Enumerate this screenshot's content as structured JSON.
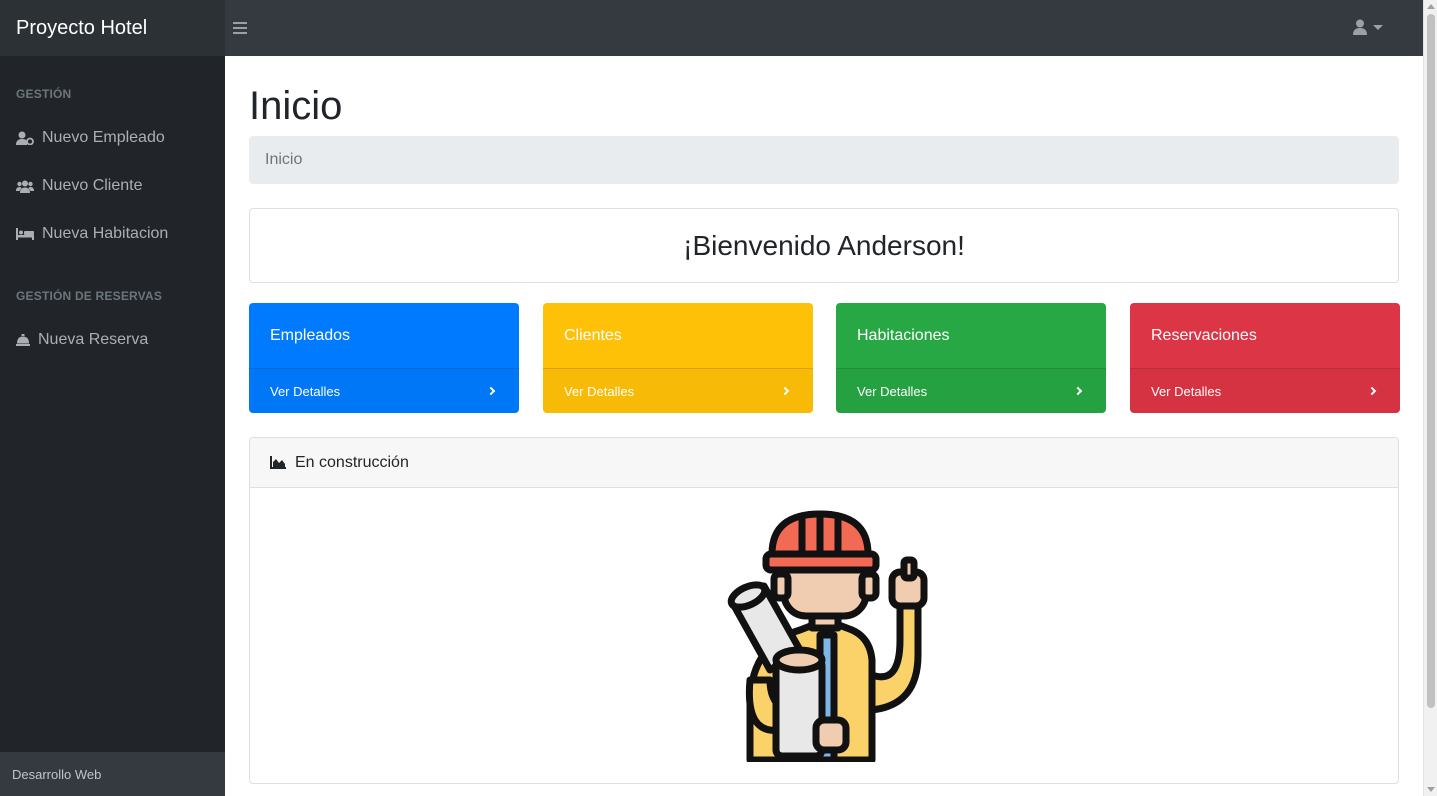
{
  "navbar": {
    "brand": "Proyecto Hotel",
    "menu_icon": "hamburger-icon",
    "user_icon": "user-icon"
  },
  "sidebar": {
    "section_gestion": "GESTIÓN",
    "items_gestion": [
      {
        "label": "Nuevo Empleado",
        "icon": "user-cog-icon"
      },
      {
        "label": "Nuevo Cliente",
        "icon": "users-icon"
      },
      {
        "label": "Nueva Habitacion",
        "icon": "bed-icon"
      }
    ],
    "section_reservas": "GESTIÓN DE RESERVAS",
    "items_reservas": [
      {
        "label": "Nueva Reserva",
        "icon": "concierge-bell-icon"
      }
    ],
    "footer": "Desarrollo Web"
  },
  "main": {
    "title": "Inicio",
    "breadcrumb": "Inicio",
    "welcome": "¡Bienvenido Anderson!",
    "cards": [
      {
        "title": "Empleados",
        "link": "Ver Detalles",
        "color": "#007bff"
      },
      {
        "title": "Clientes",
        "link": "Ver Detalles",
        "color": "#ffc107"
      },
      {
        "title": "Habitaciones",
        "link": "Ver Detalles",
        "color": "#28a745"
      },
      {
        "title": "Reservaciones",
        "link": "Ver Detalles",
        "color": "#dc3545"
      }
    ],
    "construction": {
      "header": "En construcción",
      "icon": "chart-area-icon",
      "illustration": "construction-worker-illustration"
    }
  }
}
